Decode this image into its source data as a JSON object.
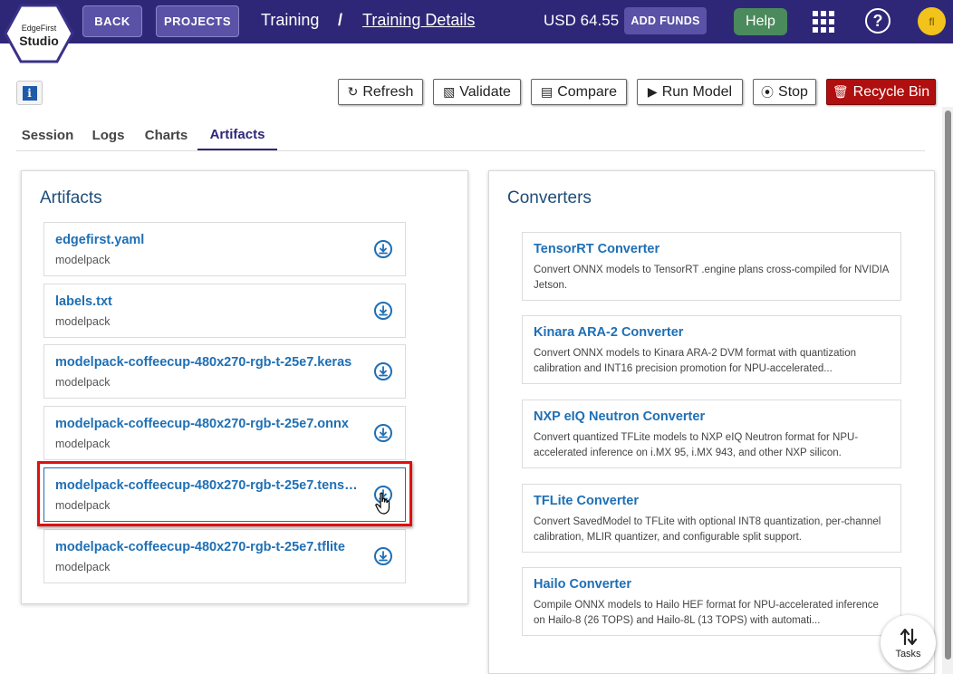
{
  "header": {
    "logo_line1": "EdgeFirst",
    "logo_line2": "Studio",
    "back_label": "BACK",
    "projects_label": "PROJECTS",
    "breadcrumb_root": "Training",
    "breadcrumb_sep": "/",
    "breadcrumb_current": "Training Details",
    "balance": "USD 64.55",
    "add_funds_label": "ADD FUNDS",
    "help_label": "Help",
    "avatar_initial": "fl",
    "icons": [
      "apps-grid-icon",
      "help-circle-icon"
    ]
  },
  "toolbar": {
    "info_label": "i",
    "refresh": "Refresh",
    "validate": "Validate",
    "compare": "Compare",
    "run_model": "Run Model",
    "stop": "Stop",
    "recycle_bin": "Recycle Bin"
  },
  "tabs": [
    {
      "label": "Session",
      "active": false
    },
    {
      "label": "Logs",
      "active": false
    },
    {
      "label": "Charts",
      "active": false
    },
    {
      "label": "Artifacts",
      "active": true
    }
  ],
  "artifacts": {
    "title": "Artifacts",
    "items": [
      {
        "name": "edgefirst.yaml",
        "type": "modelpack"
      },
      {
        "name": "labels.txt",
        "type": "modelpack"
      },
      {
        "name": "modelpack-coffeecup-480x270-rgb-t-25e7.keras",
        "type": "modelpack"
      },
      {
        "name": "modelpack-coffeecup-480x270-rgb-t-25e7.onnx",
        "type": "modelpack"
      },
      {
        "name": "modelpack-coffeecup-480x270-rgb-t-25e7.tenso...",
        "type": "modelpack",
        "selected": true
      },
      {
        "name": "modelpack-coffeecup-480x270-rgb-t-25e7.tflite",
        "type": "modelpack"
      }
    ]
  },
  "converters": {
    "title": "Converters",
    "items": [
      {
        "title": "TensorRT Converter",
        "desc": "Convert ONNX models to TensorRT .engine plans cross-compiled for NVIDIA Jetson."
      },
      {
        "title": "Kinara ARA-2 Converter",
        "desc": "Convert ONNX models to Kinara ARA-2 DVM format with quantization calibration and INT16 precision promotion for NPU-accelerated..."
      },
      {
        "title": "NXP eIQ Neutron Converter",
        "desc": "Convert quantized TFLite models to NXP eIQ Neutron format for NPU-accelerated inference on i.MX 95, i.MX 943, and other NXP silicon."
      },
      {
        "title": "TFLite Converter",
        "desc": "Convert SavedModel to TFLite with optional INT8 quantization, per-channel calibration, MLIR quantizer, and configurable split support."
      },
      {
        "title": "Hailo Converter",
        "desc": "Compile ONNX models to Hailo HEF format for NPU-accelerated inference on Hailo-8 (26 TOPS) and Hailo-8L (13 TOPS) with automati..."
      }
    ]
  },
  "tasks_label": "Tasks",
  "colors": {
    "header_bg": "#2e2777",
    "link_blue": "#1e6fb5",
    "danger_red": "#b00f0f",
    "help_green": "#4a8a5c",
    "highlight_red": "#e01010"
  }
}
